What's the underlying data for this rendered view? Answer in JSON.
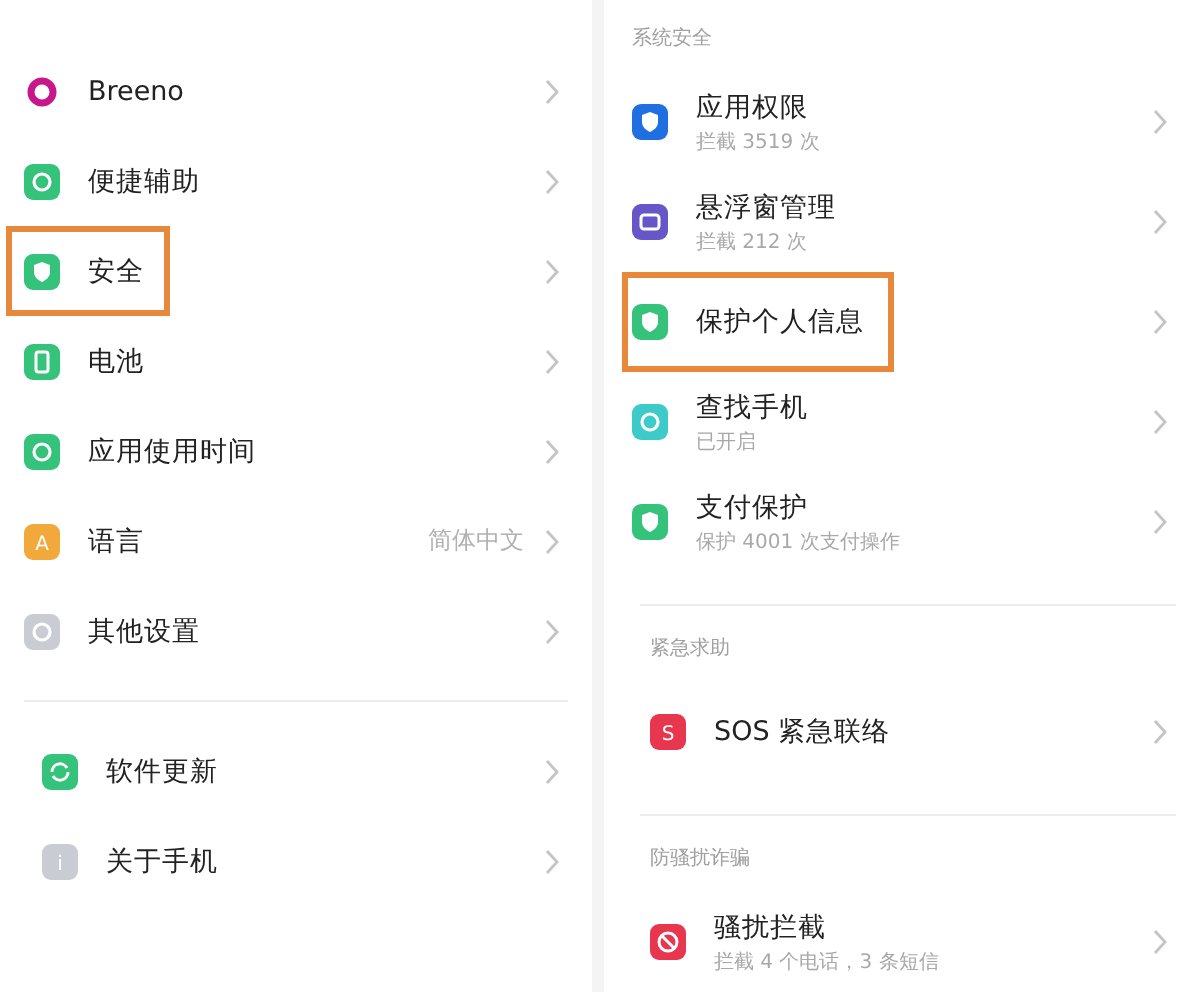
{
  "left_panel": {
    "groups": [
      {
        "items": [
          {
            "label": "Breeno",
            "kind": "ring",
            "color": "#c8178a",
            "highlighted": false
          },
          {
            "label": "便捷辅助",
            "kind": "dot",
            "color": "#35c27a",
            "highlighted": false
          },
          {
            "label": "安全",
            "kind": "shield",
            "color": "#35c27a",
            "highlighted": true
          },
          {
            "label": "电池",
            "kind": "battery",
            "color": "#35c27a",
            "highlighted": false
          },
          {
            "label": "应用使用时间",
            "kind": "dot",
            "color": "#35c27a",
            "highlighted": false
          },
          {
            "label": "语言",
            "kind": "letter",
            "icon_text": "A",
            "value": "简体中文",
            "color": "#f2a93b",
            "highlighted": false
          },
          {
            "label": "其他设置",
            "kind": "dot",
            "color": "#c9ccd3",
            "highlighted": false
          }
        ]
      },
      {
        "items": [
          {
            "label": "软件更新",
            "kind": "refresh",
            "color": "#35c27a",
            "highlighted": false
          },
          {
            "label": "关于手机",
            "kind": "letter",
            "icon_text": "i",
            "color": "#c9ccd3",
            "highlighted": false
          }
        ]
      }
    ]
  },
  "right_panel": {
    "sections": [
      {
        "header": "系统安全",
        "items": [
          {
            "label": "应用权限",
            "sublabel": "拦截 3519 次",
            "kind": "shield",
            "color": "#1f6fe0",
            "highlighted": false
          },
          {
            "label": "悬浮窗管理",
            "sublabel": "拦截 212 次",
            "kind": "box",
            "color": "#6656c8",
            "highlighted": false
          },
          {
            "label": "保护个人信息",
            "kind": "shield",
            "color": "#35c27a",
            "highlighted": true
          },
          {
            "label": "查找手机",
            "sublabel": "已开启",
            "kind": "dot",
            "color": "#3ccbc8",
            "highlighted": false
          },
          {
            "label": "支付保护",
            "sublabel": "保护 4001 次支付操作",
            "kind": "shield",
            "color": "#35c27a",
            "highlighted": false
          }
        ]
      },
      {
        "header": "紧急求助",
        "items": [
          {
            "label": "SOS 紧急联络",
            "kind": "letter",
            "icon_text": "S",
            "color": "#e8364f",
            "highlighted": false
          }
        ]
      },
      {
        "header": "防骚扰诈骗",
        "items": [
          {
            "label": "骚扰拦截",
            "sublabel": "拦截 4 个电话，3 条短信",
            "kind": "ban",
            "color": "#e8364f",
            "highlighted": false
          }
        ]
      }
    ]
  }
}
